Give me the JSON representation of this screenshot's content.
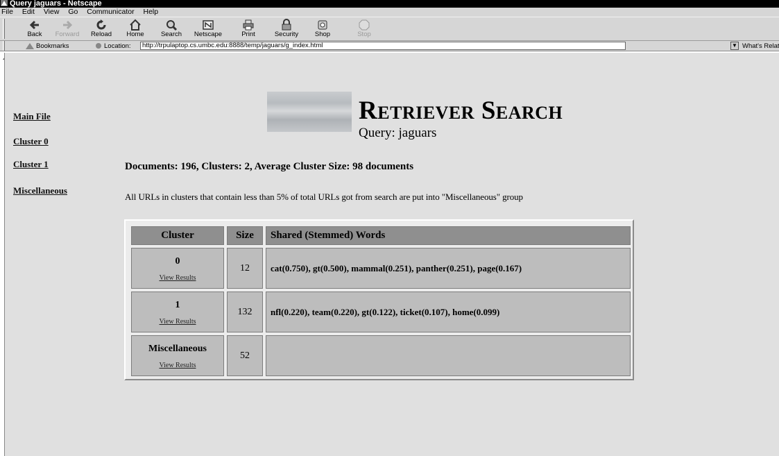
{
  "window": {
    "title": "Query jaguars - Netscape"
  },
  "menu": [
    "File",
    "Edit",
    "View",
    "Go",
    "Communicator",
    "Help"
  ],
  "toolbar": [
    {
      "label": "Back",
      "icon": "back-arrow-icon",
      "disabled": false
    },
    {
      "label": "Forward",
      "icon": "forward-arrow-icon",
      "disabled": true
    },
    {
      "label": "Reload",
      "icon": "reload-icon",
      "disabled": false
    },
    {
      "label": "Home",
      "icon": "home-icon",
      "disabled": false
    },
    {
      "label": "Search",
      "icon": "search-icon",
      "disabled": false
    },
    {
      "label": "Netscape",
      "icon": "netscape-icon",
      "disabled": false
    },
    {
      "label": "Print",
      "icon": "print-icon",
      "disabled": false
    },
    {
      "label": "Security",
      "icon": "lock-icon",
      "disabled": false
    },
    {
      "label": "Shop",
      "icon": "shop-icon",
      "disabled": false
    },
    {
      "label": "Stop",
      "icon": "stop-icon",
      "disabled": true
    }
  ],
  "location_bar": {
    "bookmarks_label": "Bookmarks",
    "location_label": "Location:",
    "url": "http://trpulaptop.cs.umbc.edu:8888/temp/jaguars/g_index.html",
    "related_label": "What's Related"
  },
  "sidebar": {
    "links": [
      "Main File",
      "Cluster 0",
      "Cluster 1",
      "Miscellaneous"
    ]
  },
  "header": {
    "title_first_big": "R",
    "title_first_rest": "ETRIEVER",
    "title_second_big": "S",
    "title_second_rest": "EARCH",
    "query_line": "Query: jaguars"
  },
  "summary": "Documents: 196, Clusters: 2, Average Cluster Size: 98 documents",
  "note": "All URLs in clusters that contain less than 5% of total URLs got from search are put into \"Miscellaneous\" group",
  "table": {
    "headers": [
      "Cluster",
      "Size",
      "Shared (Stemmed) Words"
    ],
    "rows": [
      {
        "cluster": "0",
        "link": "View Results",
        "size": "12",
        "words": "cat(0.750), gt(0.500), mammal(0.251), panther(0.251), page(0.167)"
      },
      {
        "cluster": "1",
        "link": "View Results",
        "size": "132",
        "words": "nfl(0.220), team(0.220), gt(0.122), ticket(0.107), home(0.099)"
      },
      {
        "cluster": "Miscellaneous",
        "link": "View Results",
        "size": "52",
        "words": ""
      }
    ]
  }
}
